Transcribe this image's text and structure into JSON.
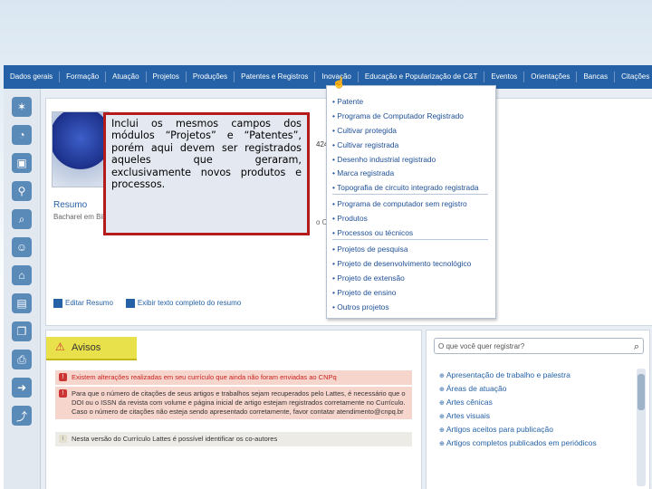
{
  "nav": {
    "tabs": [
      "Dados gerais",
      "Formação",
      "Atuação",
      "Projetos",
      "Produções",
      "Patentes e Registros",
      "Inovação",
      "Educação e Popularização de C&T",
      "Eventos",
      "Orientações",
      "Bancas",
      "Citações"
    ]
  },
  "profile": {
    "id_fragment": "4246",
    "resumo_title": "Resumo",
    "bacharel_text": "Bacharel em Bibli",
    "cfrag": "o Ca",
    "edit_resumo": "Editar Resumo",
    "full_text": "Exibir texto completo do resumo"
  },
  "dropdown": {
    "items": [
      "Patente",
      "Programa de Computador Registrado",
      "Cultivar protegida",
      "Cultivar registrada",
      "Desenho industrial registrado",
      "Marca registrada",
      "Topografia de circuito integrado registrada",
      "Programa de computador sem registro",
      "Produtos",
      "Processos ou técnicos",
      "Projetos de pesquisa",
      "Projeto de desenvolvimento tecnológico",
      "Projeto de extensão",
      "Projeto de ensino",
      "Outros projetos"
    ]
  },
  "callout": {
    "text": "Inclui os mesmos campos dos módulos “Projetos” e “Patentes”, porém aqui devem ser registrados aqueles que geraram, exclusivamente novos produtos e processos."
  },
  "avisos": {
    "title": "Avisos",
    "msg1": "Existem alterações realizadas em seu currículo que ainda não foram enviadas ao CNPq",
    "msg2": "Para que o número de citações de seus artigos e trabalhos sejam recuperados pelo Lattes, é necessário que o DOI ou o ISSN da revista com volume e página inicial de artigo estejam registrados corretamente no Currículo. Caso o número de citações não esteja sendo apresentado corretamente, favor contatar atendimento@cnpq.br",
    "msg3": "Nesta versão do Currículo Lattes é possível identificar os co-autores"
  },
  "register": {
    "search_placeholder": "O que você quer registrar?",
    "items": [
      "Apresentação de trabalho e palestra",
      "Áreas de atuação",
      "Artes cênicas",
      "Artes visuais",
      "Artigos aceitos para publicação",
      "Artigos completos publicados em periódicos"
    ]
  },
  "colors": {
    "nav": "#2461a6",
    "callout_border": "#b41c1c",
    "avisos_tab": "#e9e14b",
    "red_msg": "#f6d5cc"
  },
  "icons": [
    "star-icon",
    "pie-icon",
    "person-card-icon",
    "search-person-icon",
    "magnify-icon",
    "head-icon",
    "building-icon",
    "document-icon",
    "pages-icon",
    "printer-icon",
    "export-icon",
    "share-icon"
  ]
}
